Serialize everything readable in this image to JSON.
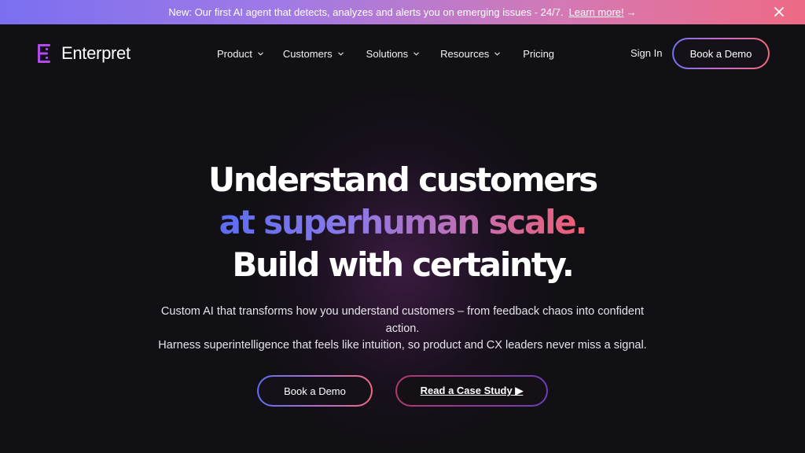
{
  "banner": {
    "message": "New: Our first AI agent that detects, analyzes and alerts you on emerging issues - 24/7.",
    "link_label": "Learn more!",
    "arrow": "→",
    "close_icon": "close-icon"
  },
  "nav": {
    "brand": "Enterpret",
    "menu": [
      {
        "label": "Product",
        "has_dropdown": true
      },
      {
        "label": "Customers",
        "has_dropdown": true
      },
      {
        "label": "Solutions",
        "has_dropdown": true
      },
      {
        "label": "Resources",
        "has_dropdown": true
      },
      {
        "label": "Pricing",
        "has_dropdown": false
      }
    ],
    "sign_in": "Sign In",
    "book_demo": "Book a Demo"
  },
  "hero": {
    "line1": "Understand customers",
    "line2": "at superhuman scale.",
    "line3": "Build with certainty.",
    "subtitle_line1": "Custom AI that transforms how you understand customers – from feedback chaos into confident action.",
    "subtitle_line2": "Harness superintelligence that feels like intuition, so product and CX leaders never miss a signal.",
    "cta_primary": "Book a Demo",
    "cta_secondary": "Read a Case Study ▶"
  },
  "colors": {
    "background": "#111014",
    "banner_gradient": [
      "#7b6ff0",
      "#ee6a84"
    ],
    "accent_gradient": [
      "#5b6cf2",
      "#f05d73"
    ],
    "logo": "#b04be8"
  }
}
